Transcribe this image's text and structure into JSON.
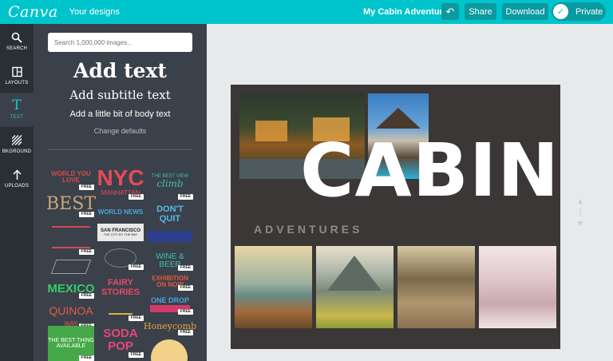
{
  "topbar": {
    "logo": "Canva",
    "your_designs": "Your designs",
    "design_title": "My Cabin Adventures",
    "undo_icon": "undo-icon",
    "share": "Share",
    "download": "Download",
    "privacy": "Private"
  },
  "rail": [
    {
      "label": "SEARCH",
      "icon": "search-icon"
    },
    {
      "label": "LAYOUTS",
      "icon": "layout-icon"
    },
    {
      "label": "TEXT",
      "icon": "text-icon"
    },
    {
      "label": "BKGROUND",
      "icon": "background-icon"
    },
    {
      "label": "UPLOADS",
      "icon": "upload-icon"
    }
  ],
  "panel": {
    "search_placeholder": "Search 1,000,000 images...",
    "add_heading": "Add text",
    "add_subtitle": "Add subtitle text",
    "add_body": "Add a little bit of body text",
    "change_defaults": "Change defaults",
    "free_badge": "FREE",
    "templates": {
      "world_you_love": "WORLD YOU LOVE",
      "nyc": "NYC",
      "manhattan": "MANHATTAN",
      "best_view": "THE BEST VIEW",
      "climb": "climb",
      "best": "BEST",
      "world_news": "WORLD NEWS",
      "dont_quit": "DON'T QUIT",
      "san_francisco": "SAN FRANCISCO",
      "city_by_bay": "THE CITY BY THE BAY",
      "mexico": "MEXICO",
      "fairy_stories": "FAIRY STORIES",
      "exhibition": "EXHIBITION ON NOW",
      "wine": "WINE & BEER",
      "one_drop": "ONE DROP",
      "quinoa": "QUINOA",
      "way": "WAY",
      "soda_pop": "SODA POP",
      "honeycomb": "Honeycomb",
      "best_thing": "THE BEST THING AVAILABLE"
    }
  },
  "design": {
    "title_main": "CABIN",
    "title_sub": "ADVENTURES",
    "colors": {
      "background": "#3b3736",
      "title": "#ffffff",
      "subtitle": "#8e8a88"
    }
  }
}
